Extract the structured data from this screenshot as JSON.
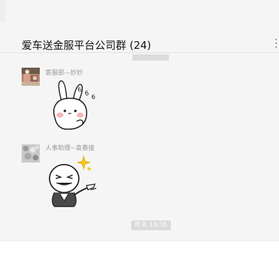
{
  "header": {
    "title": "爱车送金服平台公司群 (24)",
    "more_icon": "more-icon"
  },
  "messages": [
    {
      "sender": "客服部—妙妙",
      "content_type": "sticker",
      "sticker": "bunny-blushing-sticker"
    },
    {
      "sender": "人事助理~袁春接",
      "content_type": "sticker",
      "sticker": "pointing-meme-sticker"
    }
  ],
  "time_divider": {
    "label": "昨天 19:36"
  },
  "colors": {
    "chat_background": "#f5f5f5",
    "time_chip": "#dadada",
    "sender_name": "#999999"
  }
}
